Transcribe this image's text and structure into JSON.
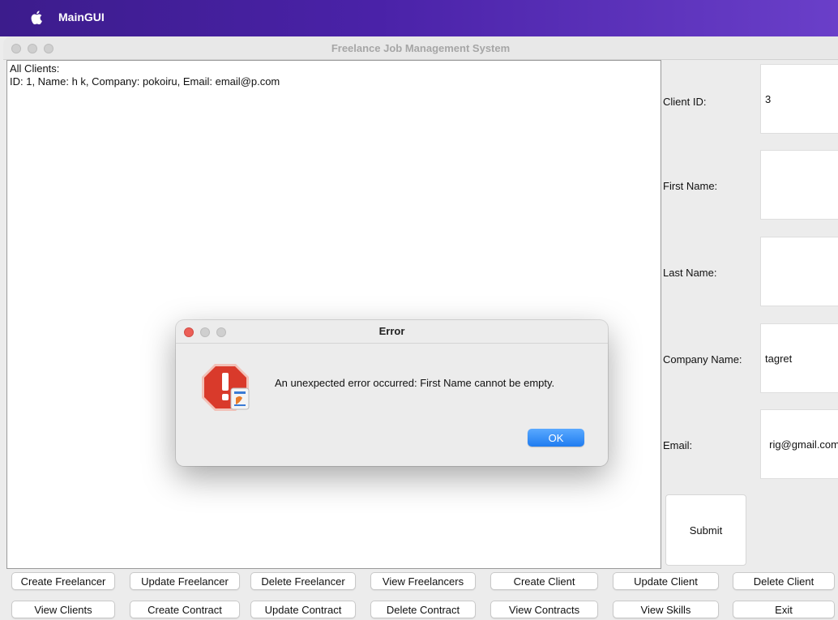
{
  "menubar": {
    "apple_icon": "apple-icon",
    "app_name": "MainGUI"
  },
  "window": {
    "title": "Freelance Job Management System"
  },
  "output": {
    "text": "All Clients:\nID: 1, Name: h k, Company: pokoiru, Email: email@p.com"
  },
  "form": {
    "client_id_label": "Client ID:",
    "client_id_value": "3",
    "first_name_label": "First Name:",
    "first_name_value": "",
    "last_name_label": "Last Name:",
    "last_name_value": "",
    "company_label": "Company Name:",
    "company_value": "tagret",
    "email_label": "Email:",
    "email_value": "rig@gmail.com",
    "submit_label": "Submit"
  },
  "buttons": {
    "row1": [
      "Create Freelancer",
      "Update Freelancer",
      "Delete Freelancer",
      "View Freelancers",
      "Create Client",
      "Update Client",
      "Delete Client"
    ],
    "row2": [
      "View Clients",
      "Create Contract",
      "Update Contract",
      "Delete Contract",
      "View Contracts",
      "View Skills",
      "Exit"
    ]
  },
  "dialog": {
    "title": "Error",
    "message": "An unexpected error occurred: First Name cannot be empty.",
    "ok_label": "OK",
    "icon": "error-stop-icon",
    "close_color": "#ec5f57"
  },
  "colors": {
    "accent": "#1f7cf0",
    "menubar": "#4a22a8",
    "error_red": "#d93a2b"
  }
}
